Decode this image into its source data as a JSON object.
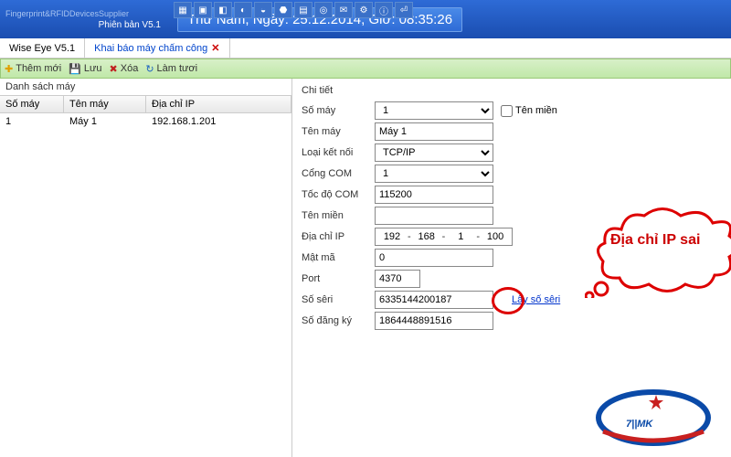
{
  "header": {
    "supplier": "Fingerprint&RFIDDevicesSupplier",
    "version": "Phiên bản V5.1",
    "datetime": "Thứ Năm, Ngày: 25.12.2014, Giờ: 08:35:26"
  },
  "tabs": {
    "home": "Wise Eye V5.1",
    "active": "Khai báo máy chấm công"
  },
  "actions": {
    "add": "Thêm mới",
    "save": "Lưu",
    "delete": "Xóa",
    "refresh": "Làm tươi"
  },
  "listPanel": {
    "title": "Danh sách máy",
    "cols": {
      "c1": "Số máy",
      "c2": "Tên máy",
      "c3": "Địa chỉ IP"
    },
    "row": {
      "c1": "1",
      "c2": "Máy 1",
      "c3": "192.168.1.201"
    }
  },
  "detailPanel": {
    "title": "Chi tiết",
    "labels": {
      "somay": "Số máy",
      "tenmien_chk": "Tên miền",
      "tenmay": "Tên máy",
      "loaiketnoi": "Loại kết nối",
      "congcom": "Cổng COM",
      "tocdocom": "Tốc độ COM",
      "tenmien": "Tên miền",
      "diachiip": "Địa chỉ IP",
      "matma": "Mật mã",
      "port": "Port",
      "soseri": "Số sêri",
      "sodangky": "Số đăng ký"
    },
    "values": {
      "somay": "1",
      "tenmay": "Máy 1",
      "loaiketnoi": "TCP/IP",
      "congcom": "1",
      "tocdocom": "115200",
      "tenmien": "",
      "ip1": "192",
      "ip2": "168",
      "ip3": "1",
      "ip4": "100",
      "matma": "0",
      "port": "4370",
      "soseri": "6335144200187",
      "sodangky": "1864448891516"
    },
    "link_seri": "Lấy số sêri"
  },
  "annotation": {
    "text": "Địa chỉ IP sai"
  }
}
